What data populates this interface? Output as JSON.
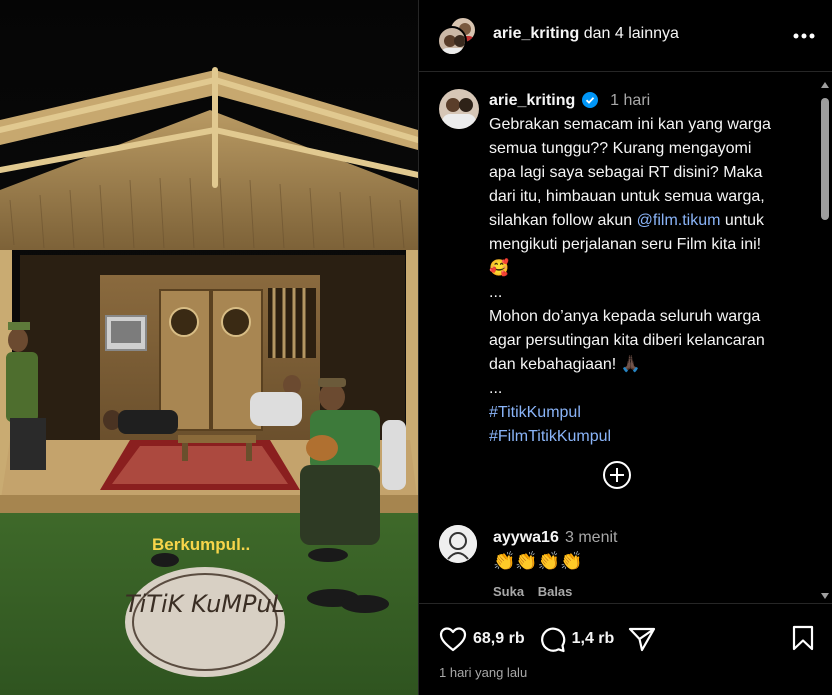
{
  "photo": {
    "overlay_text": "Berkumpul..",
    "rug_text": "TiTiK KuMPuL"
  },
  "header": {
    "username": "arie_kriting",
    "others": "dan 4 lainnya",
    "more_icon": "more-horizontal-icon"
  },
  "caption": {
    "username": "arie_kriting",
    "time": "1 hari",
    "lines": [
      "Gebrakan semacam ini kan yang warga",
      "semua tunggu?? Kurang mengayomi",
      "apa lagi saya sebagai RT disini? Maka",
      "dari itu, himbauan untuk semua warga,"
    ],
    "line5_prefix": "silahkan follow akun ",
    "mention": "@film.tikum",
    "line5_suffix": " untuk",
    "line6": "mengikuti perjalanan seru Film kita ini!",
    "emoji_1": "🥰",
    "dots_1": "...",
    "lines_2": [
      "Mohon do’anya kepada seluruh warga",
      "agar persutingan kita diberi kelancaran"
    ],
    "line_last": "dan kebahagiaan! ",
    "emoji_2": "🙏🏿",
    "dots_2": "...",
    "hashtags": [
      "#TitikKumpul",
      "#FilmTitikKumpul"
    ]
  },
  "comment": {
    "username": "ayywa16",
    "time": "3 menit",
    "text": "👏👏👏👏",
    "like_label": "Suka",
    "reply_label": "Balas"
  },
  "footer": {
    "likes": "68,9 rb",
    "comments": "1,4 rb",
    "posted": "1 hari yang lalu"
  },
  "colors": {
    "background": "#000000",
    "text": "#f5f5f5",
    "muted": "#a8a8a8",
    "link": "#8ab4f8",
    "verified": "#0095f6",
    "border": "#262626"
  }
}
